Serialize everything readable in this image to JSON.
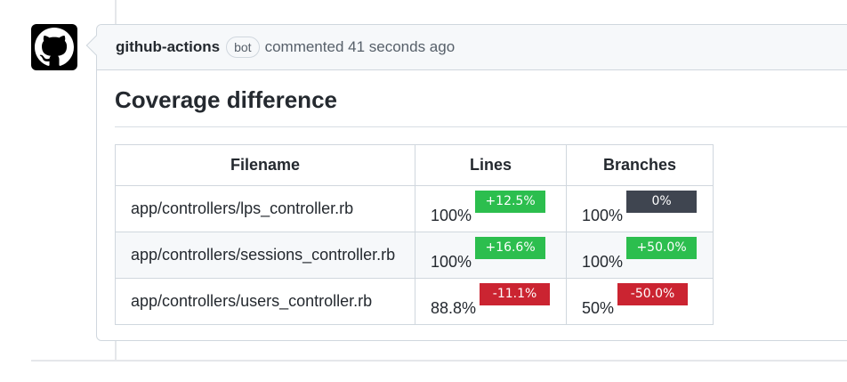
{
  "comment": {
    "author": "github-actions",
    "badge": "bot",
    "action": "commented 41 seconds ago",
    "avatar_icon": "github-octocat-icon"
  },
  "report": {
    "heading": "Coverage difference",
    "headers": [
      "Filename",
      "Lines",
      "Branches"
    ],
    "rows": [
      {
        "filename": "app/controllers/lps_controller.rb",
        "lines": "100%",
        "lines_diff": "+12.5%",
        "branches": "100%",
        "branches_diff": "0%"
      },
      {
        "filename": "app/controllers/sessions_controller.rb",
        "lines": "100%",
        "lines_diff": "+16.6%",
        "branches": "100%",
        "branches_diff": "+50.0%"
      },
      {
        "filename": "app/controllers/users_controller.rb",
        "lines": "88.8%",
        "lines_diff": "-11.1%",
        "branches": "50%",
        "branches_diff": "-50.0%"
      }
    ]
  },
  "colors": {
    "increase": "#2cbe4e",
    "unchanged": "#3f4550",
    "decrease": "#cb2431"
  }
}
